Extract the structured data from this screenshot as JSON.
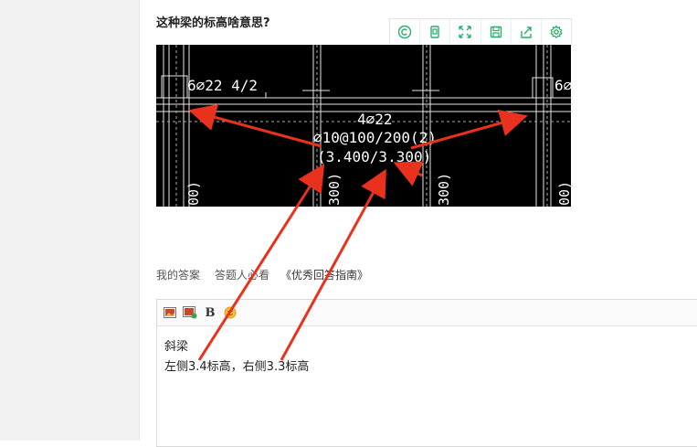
{
  "question": {
    "title": "这种梁的标高啥意思?"
  },
  "image_toolbar": {
    "icons": [
      "copyright-icon",
      "crop-icon",
      "fullscreen-icon",
      "save-icon",
      "share-icon",
      "settings-icon"
    ]
  },
  "drawing": {
    "beam_mark_left": "6⌀22 4/2",
    "beam_mark_right": "6⌀",
    "top_rebar": "4⌀22",
    "stirrup": "⌀10@100/200(2)",
    "elevation": "(3.400/3.300)",
    "col_label_1": "00)",
    "col_label_2": "300)",
    "col_label_3": "300)",
    "col_label_4": "00)"
  },
  "answer_tabs": {
    "my_answer": "我的答案",
    "must_read": "答题人必看",
    "guide": "《优秀回答指南》"
  },
  "editor": {
    "bold_label": "B",
    "lines": [
      "斜梁",
      "左侧3.4标高，右侧3.3标高"
    ]
  },
  "colors": {
    "accent_green": "#2aae67",
    "arrow_red": "#e8321e"
  }
}
